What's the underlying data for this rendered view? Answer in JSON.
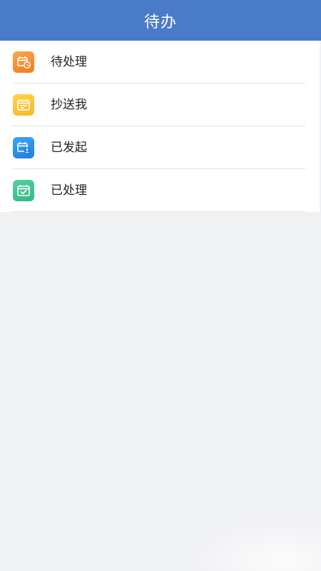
{
  "header": {
    "title": "待办"
  },
  "colors": {
    "header_bg": "#4a7bc8",
    "orange": "#f28a2a",
    "yellow": "#f9c43a",
    "blue": "#2a8ee8",
    "green": "#3fc58f"
  },
  "list": {
    "items": [
      {
        "label": "待处理",
        "icon": "calendar-clock-icon"
      },
      {
        "label": "抄送我",
        "icon": "calendar-note-icon"
      },
      {
        "label": "已发起",
        "icon": "calendar-user-icon"
      },
      {
        "label": "已处理",
        "icon": "calendar-check-icon"
      }
    ]
  }
}
